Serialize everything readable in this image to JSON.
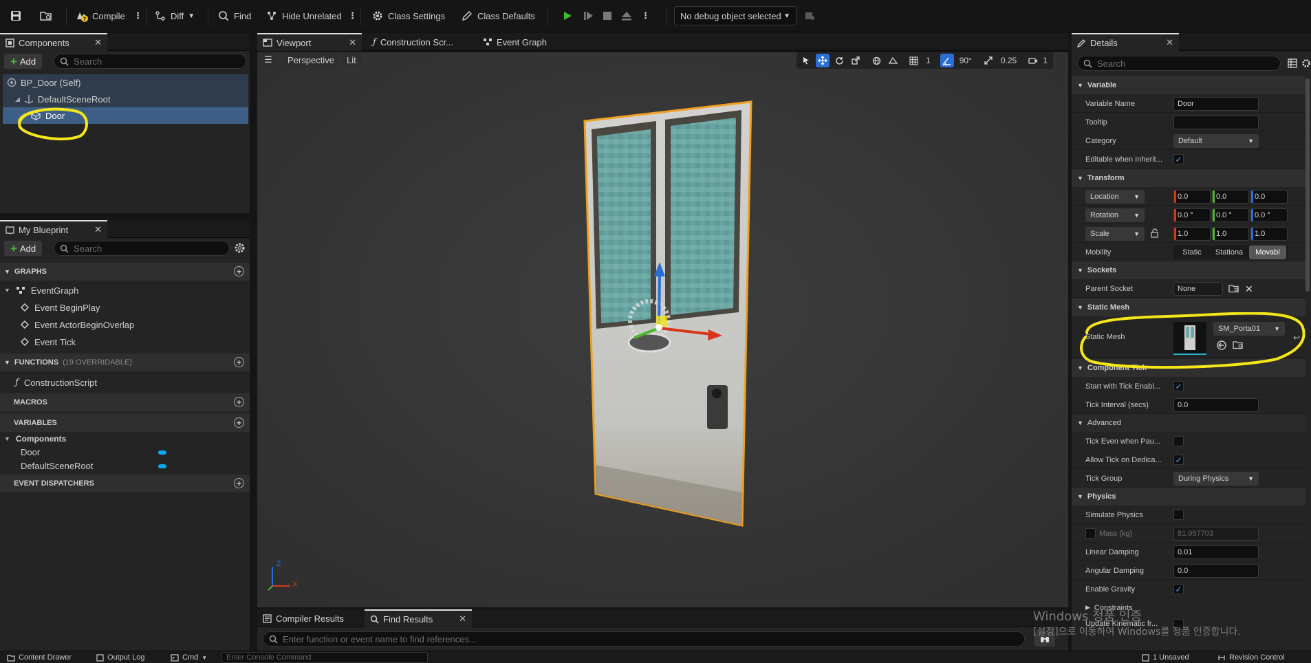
{
  "toolbar": {
    "compile": "Compile",
    "diff": "Diff",
    "find": "Find",
    "hide_unrelated": "Hide Unrelated",
    "class_settings": "Class Settings",
    "class_defaults": "Class Defaults",
    "debug_object": "No debug object selected"
  },
  "components_panel": {
    "tab": "Components",
    "add": "Add",
    "search_placeholder": "Search",
    "tree": [
      "BP_Door (Self)",
      "DefaultSceneRoot",
      "Door"
    ]
  },
  "my_blueprint": {
    "tab": "My Blueprint",
    "add": "Add",
    "search_placeholder": "Search",
    "graphs_header": "GRAPHS",
    "event_graph": "EventGraph",
    "events": [
      "Event BeginPlay",
      "Event ActorBeginOverlap",
      "Event Tick"
    ],
    "functions_header": "FUNCTIONS",
    "functions_overridable": "(19 OVERRIDABLE)",
    "construction_script": "ConstructionScript",
    "macros_header": "MACROS",
    "variables_header": "VARIABLES",
    "components_group": "Components",
    "variables": [
      "Door",
      "DefaultSceneRoot"
    ],
    "variable_color": "#0aa8f0",
    "event_dispatchers_header": "EVENT DISPATCHERS"
  },
  "center_tabs": [
    "Viewport",
    "Construction Scr...",
    "Event Graph"
  ],
  "viewport": {
    "perspective": "Perspective",
    "lit": "Lit",
    "grid_value": "1",
    "angle_value": "90°",
    "scale_value": "0.25",
    "camera_value": "1",
    "axis_z": "Z",
    "axis_x": "X"
  },
  "bottom": {
    "tabs": [
      "Compiler Results",
      "Find Results"
    ],
    "find_placeholder": "Enter function or event name to find references..."
  },
  "details": {
    "tab": "Details",
    "search_placeholder": "Search",
    "sections": {
      "variable": "Variable",
      "transform": "Transform",
      "sockets": "Sockets",
      "static_mesh": "Static Mesh",
      "component_tick": "Component Tick",
      "advanced": "Advanced",
      "physics": "Physics",
      "constraints": "Constraints"
    },
    "variable_name_label": "Variable Name",
    "variable_name": "Door",
    "tooltip_label": "Tooltip",
    "tooltip": "",
    "category_label": "Category",
    "category": "Default",
    "editable_label": "Editable when Inherit...",
    "location_label": "Location",
    "location": [
      "0.0",
      "0.0",
      "0.0"
    ],
    "rotation_label": "Rotation",
    "rotation": [
      "0.0 °",
      "0.0 °",
      "0.0 °"
    ],
    "scale_label": "Scale",
    "scale": [
      "1.0",
      "1.0",
      "1.0"
    ],
    "mobility_label": "Mobility",
    "mobility_options": [
      "Static",
      "Stationa",
      "Movabl"
    ],
    "parent_socket_label": "Parent Socket",
    "parent_socket": "None",
    "static_mesh_label": "Static Mesh",
    "static_mesh": "SM_Porta01",
    "start_tick_label": "Start with Tick Enabl...",
    "tick_interval_label": "Tick Interval (secs)",
    "tick_interval": "0.0",
    "tick_even_label": "Tick Even when Pau...",
    "allow_tick_label": "Allow Tick on Dedica...",
    "tick_group_label": "Tick Group",
    "tick_group": "During Physics",
    "simulate_label": "Simulate Physics",
    "mass_label": "Mass (kg)",
    "mass": "81.957703",
    "linear_damping_label": "Linear Damping",
    "linear_damping": "0.01",
    "angular_damping_label": "Angular Damping",
    "angular_damping": "0.0",
    "gravity_label": "Enable Gravity",
    "kinematic_label": "Update Kinematic fr..."
  },
  "statusbar": {
    "content_drawer": "Content Drawer",
    "output_log": "Output Log",
    "cmd": "Cmd",
    "console_placeholder": "Enter Console Command",
    "unsaved": "1 Unsaved",
    "revision": "Revision Control"
  },
  "watermark": {
    "line1": "Windows 정품 인증",
    "line2": "[설정]으로 이동하여 Windows를 정품 인증합니다."
  },
  "colors": {
    "accent_blue": "#2a6fd6",
    "highlight_yellow": "#f5e61a",
    "play_green": "#3cba2f",
    "selection_orange": "#f0a020"
  }
}
